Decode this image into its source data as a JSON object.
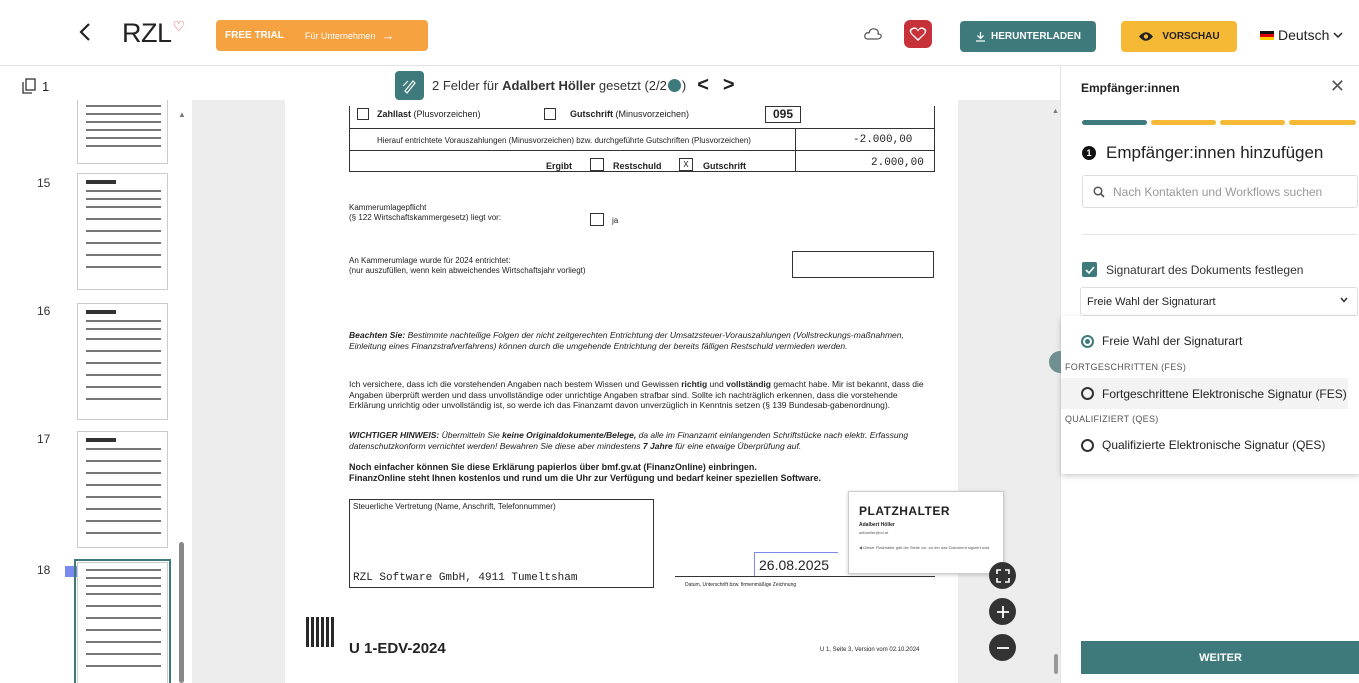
{
  "header": {
    "logo_text": "RZL",
    "trial_label": "FREE TRIAL",
    "trial_sub": "Für Unternehmen",
    "trial_arrow": "→",
    "download_label": "HERUNTERLADEN",
    "preview_label": "VORSCHAU",
    "language": "Deutsch"
  },
  "toolbar": {
    "page_count": "1",
    "fields_count": "2 Felder für",
    "fields_person": "Adalbert Höller",
    "fields_status": "gesetzt (2/2",
    "fields_close": ")"
  },
  "thumbnails": [
    {
      "label": "15"
    },
    {
      "label": "16"
    },
    {
      "label": "17"
    },
    {
      "label": "18"
    }
  ],
  "document": {
    "zahllast": "Zahllast",
    "zahllast_note": "(Plusvorzeichen)",
    "gutschrift": "Gutschrift",
    "gutschrift_note": "(Minusvorzeichen)",
    "code": "095",
    "hierauf": "Hierauf entrichtete Vorauszahlungen (Minusvorzeichen) bzw. durchgeführte Gutschriften (Plusvorzeichen)",
    "amount1": "-2.000,00",
    "ergibt": "Ergibt",
    "restschuld": "Restschuld",
    "x_mark": "X",
    "gutschrift2": "Gutschrift",
    "amount2": "2.000,00",
    "kammer_l1": "Kammerumlagepflicht",
    "kammer_l2": "(§ 122 Wirtschaftskammergesetz) liegt vor:",
    "ja": "ja",
    "kammer2_l1": "An Kammerumlage wurde für 2024 entrichtet:",
    "kammer2_l2": "(nur auszufüllen, wenn kein abweichendes Wirtschaftsjahr vorliegt)",
    "beachten_b": "Beachten Sie:",
    "beachten": "Bestimmte nachteilige Folgen der nicht zeitgerechten Entrichtung der Umsatzsteuer-Vorauszahlungen (Vollstreckungs-maßnahmen, Einleitung eines Finanzstrafverfahrens) können durch die umgehende Entrichtung der bereits fälligen Restschuld vermieden werden.",
    "versichere_1": "Ich versichere, dass ich die vorstehenden Angaben nach bestem Wissen und Gewissen",
    "versichere_richtig": "richtig",
    "versichere_und": "und",
    "versichere_vollst": "vollständig",
    "versichere_2": "gemacht habe. Mir ist bekannt, dass die Angaben überprüft werden und dass unvollständige oder unrichtige Angaben strafbar sind. Sollte ich nachträglich erkennen, dass die vorstehende Erklärung unrichtig oder unvollständig ist, so werde ich das Finanzamt davon unverzüglich in Kenntnis setzen (§ 139 Bundesab-gabenordnung).",
    "hinweis_b": "WICHTIGER HINWEIS:",
    "hinweis_1": "Übermitteln Sie",
    "hinweis_keine": "keine Originaldokumente/Belege,",
    "hinweis_2": "da alle im Finanzamt einlangenden Schriftstücke nach elektr. Erfassung datenschutzkonform vernichtet werden! Bewahren Sie diese aber mindestens",
    "hinweis_7": "7 Jahre",
    "hinweis_3": "für eine etwaige Überprüfung auf.",
    "noch_1": "Noch einfacher können Sie diese Erklärung papierlos über bmf.gv.at (FinanzOnline) einbringen.",
    "noch_2": "FinanzOnline steht Ihnen kostenlos und rund um die Uhr zur Verfügung und bedarf keiner speziellen Software.",
    "vertretung_label": "Steuerliche Vertretung (Name, Anschrift, Telefonnummer)",
    "vertretung_value": "RZL Software GmbH, 4911 Tumeltsham",
    "date_value": "26.08.2025",
    "datum_label": "Datum, Unterschrift bzw. firmenmäßige Zeichnung",
    "form_id": "U 1-EDV-2024",
    "form_version": "U 1, Seite 3, Version vom 02.10.2024"
  },
  "placeholder": {
    "title": "PLATZHALTER",
    "name": "Adalbert Höller",
    "email": "adhoeller@rzl.at",
    "footer": "Dieser Platzhalter gibt die Stelle vor, an der das Dokument signiert wird."
  },
  "panel": {
    "header": "Empfänger:innen",
    "step_number": "1",
    "title": "Empfänger:innen hinzufügen",
    "search_placeholder": "Nach Kontakten und Workflows suchen",
    "checkbox_label": "Signaturart des Dokuments festlegen",
    "select_value": "Freie Wahl der Signaturart",
    "option_free": "Freie Wahl der Signaturart",
    "group_fes": "FORTGESCHRITTEN (FES)",
    "option_fes": "Fortgeschrittene Elektronische Signatur (FES)",
    "group_qes": "QUALIFIZIERT (QES)",
    "option_qes": "Qualifizierte Elektronische Signatur (QES)",
    "next_label": "WEITER"
  },
  "colors": {
    "accent": "#3e7a7c",
    "trial": "#f6a241",
    "preview": "#f6b936",
    "step_active": "#3e7a7c",
    "step_inactive": "#f6b936"
  }
}
